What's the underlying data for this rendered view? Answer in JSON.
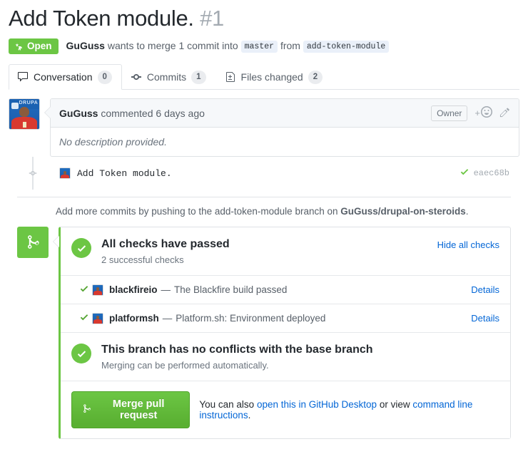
{
  "pull_request": {
    "title": "Add Token module.",
    "number": "#1",
    "state": "Open",
    "state_color": "#6cc644",
    "author": "GuGuss",
    "meta_prefix": "wants to merge 1 commit into",
    "base_branch": "master",
    "meta_from": "from",
    "head_branch": "add-token-module"
  },
  "tabs": [
    {
      "label": "Conversation",
      "count": "0",
      "icon": "comment-discussion-icon",
      "selected": true
    },
    {
      "label": "Commits",
      "count": "1",
      "icon": "git-commit-icon",
      "selected": false
    },
    {
      "label": "Files changed",
      "count": "2",
      "icon": "diff-file-icon",
      "selected": false
    }
  ],
  "comment": {
    "author": "GuGuss",
    "action": "commented",
    "time": "6 days ago",
    "owner_label": "Owner",
    "react_label": "+",
    "body": "No description provided."
  },
  "commit": {
    "message": "Add Token module.",
    "sha": "eaec68b"
  },
  "push_hint": {
    "prefix": "Add more commits by pushing to the",
    "branch": "add-token-module",
    "middle": "branch on",
    "repo": "GuGuss/drupal-on-steroids",
    "suffix": "."
  },
  "merge_status": {
    "checks_heading": "All checks have passed",
    "checks_sub": "2 successful checks",
    "hide_checks_label": "Hide all checks",
    "checks": [
      {
        "name": "blackfireio",
        "separator": "—",
        "description": "The Blackfire build passed",
        "details_label": "Details",
        "status": "success"
      },
      {
        "name": "platformsh",
        "separator": "—",
        "description": "Platform.sh: Environment deployed",
        "details_label": "Details",
        "status": "success"
      }
    ],
    "conflict_heading": "This branch has no conflicts with the base branch",
    "conflict_sub": "Merging can be performed automatically.",
    "merge_button_label": "Merge pull request",
    "footer_prefix": "You can also",
    "footer_link_1": "open this in GitHub Desktop",
    "footer_middle": "or view",
    "footer_link_2": "command line instructions",
    "footer_suffix": "."
  },
  "colors": {
    "green": "#6cc644",
    "link_blue": "#0366d6",
    "muted": "#586069"
  }
}
